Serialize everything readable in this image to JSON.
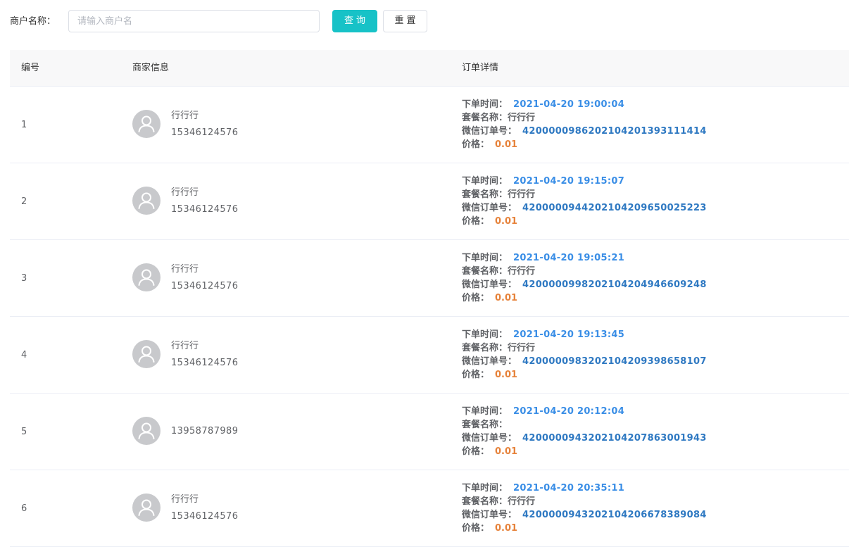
{
  "search": {
    "label": "商户名称：",
    "placeholder": "请输入商户名",
    "value": "",
    "query_button": "查询",
    "reset_button": "重置"
  },
  "table": {
    "headers": [
      "编号",
      "商家信息",
      "订单详情"
    ],
    "order_labels": {
      "time": "下单时间：",
      "package": "套餐名称：",
      "wechat_order": "微信订单号：",
      "price": "价格："
    },
    "rows": [
      {
        "id": "1",
        "name": "行行行",
        "phone": "15346124576",
        "time": "2021-04-20 19:00:04",
        "package": "行行行",
        "wechat_order": "4200000986202104201393111414",
        "price": "0.01"
      },
      {
        "id": "2",
        "name": "行行行",
        "phone": "15346124576",
        "time": "2021-04-20 19:15:07",
        "package": "行行行",
        "wechat_order": "4200000944202104209650025223",
        "price": "0.01"
      },
      {
        "id": "3",
        "name": "行行行",
        "phone": "15346124576",
        "time": "2021-04-20 19:05:21",
        "package": "行行行",
        "wechat_order": "4200000998202104204946609248",
        "price": "0.01"
      },
      {
        "id": "4",
        "name": "行行行",
        "phone": "15346124576",
        "time": "2021-04-20 19:13:45",
        "package": "行行行",
        "wechat_order": "4200000983202104209398658107",
        "price": "0.01"
      },
      {
        "id": "5",
        "name": "",
        "phone": "13958787989",
        "time": "2021-04-20 20:12:04",
        "package": "",
        "wechat_order": "4200000943202104207863001943",
        "price": "0.01"
      },
      {
        "id": "6",
        "name": "行行行",
        "phone": "15346124576",
        "time": "2021-04-20 20:35:11",
        "package": "行行行",
        "wechat_order": "4200000943202104206678389084",
        "price": "0.01"
      }
    ]
  },
  "colors": {
    "primary_button": "#17c2c7",
    "time_value": "#3a8ee6",
    "wechat_order_value": "#2f79c2",
    "price_value": "#e6823a",
    "avatar_bg": "#c8c9cc"
  },
  "icons": {
    "avatar": "user-avatar-icon"
  }
}
